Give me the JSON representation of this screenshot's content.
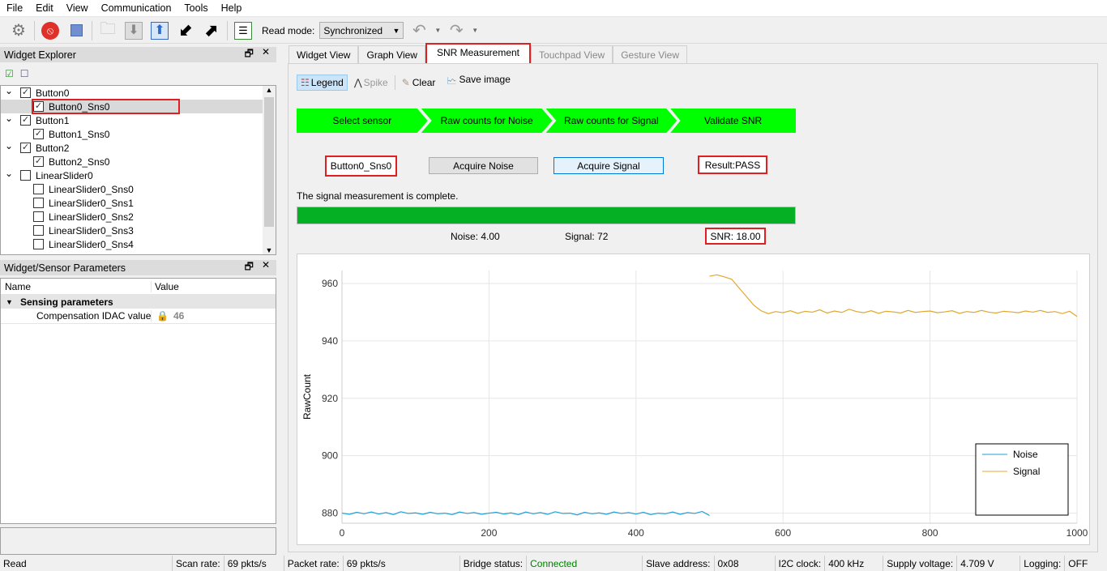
{
  "menu": [
    "File",
    "Edit",
    "View",
    "Communication",
    "Tools",
    "Help"
  ],
  "toolbar": {
    "read_mode_label": "Read mode:",
    "read_mode_value": "Synchronized"
  },
  "widget_explorer": {
    "title": "Widget Explorer",
    "items": [
      {
        "label": "Button0",
        "level": 0,
        "checked": true
      },
      {
        "label": "Button0_Sns0",
        "level": 1,
        "checked": true,
        "selected": true
      },
      {
        "label": "Button1",
        "level": 0,
        "checked": true
      },
      {
        "label": "Button1_Sns0",
        "level": 1,
        "checked": true
      },
      {
        "label": "Button2",
        "level": 0,
        "checked": true
      },
      {
        "label": "Button2_Sns0",
        "level": 1,
        "checked": true
      },
      {
        "label": "LinearSlider0",
        "level": 0,
        "checked": false
      },
      {
        "label": "LinearSlider0_Sns0",
        "level": 1,
        "checked": false
      },
      {
        "label": "LinearSlider0_Sns1",
        "level": 1,
        "checked": false
      },
      {
        "label": "LinearSlider0_Sns2",
        "level": 1,
        "checked": false
      },
      {
        "label": "LinearSlider0_Sns3",
        "level": 1,
        "checked": false
      },
      {
        "label": "LinearSlider0_Sns4",
        "level": 1,
        "checked": false
      }
    ]
  },
  "params": {
    "title": "Widget/Sensor Parameters",
    "col_name": "Name",
    "col_value": "Value",
    "group": "Sensing parameters",
    "row_name": "Compensation IDAC value",
    "row_value": "46"
  },
  "tabs": [
    {
      "label": "Widget View"
    },
    {
      "label": "Graph View"
    },
    {
      "label": "SNR Measurement",
      "active": true
    },
    {
      "label": "Touchpad View",
      "disabled": true
    },
    {
      "label": "Gesture View",
      "disabled": true
    }
  ],
  "snr_toolbar": {
    "legend": "Legend",
    "spike": "Spike",
    "clear": "Clear",
    "save_image": "Save image"
  },
  "steps": [
    "Select sensor",
    "Raw counts for Noise",
    "Raw counts for Signal",
    "Validate SNR"
  ],
  "sensor": "Button0_Sns0",
  "acquire_noise": "Acquire Noise",
  "acquire_signal": "Acquire Signal",
  "result": "Result:PASS",
  "message": "The signal measurement is complete.",
  "progress_percent": 100,
  "noise_label": "Noise:  4.00",
  "signal_label": "Signal:  72",
  "snr_label": "SNR:  18.00",
  "colors": {
    "step": "#00ff00",
    "progress": "#06b025",
    "noise": "#1f9fd6",
    "signal": "#e0a830",
    "highlight": "#e02020",
    "connected": "#008000"
  },
  "chart_data": {
    "type": "line",
    "xlabel": "",
    "ylabel": "RawCount",
    "xlim": [
      0,
      1000
    ],
    "ylim": [
      876.5,
      964.5
    ],
    "xticks": [
      0,
      200,
      400,
      600,
      800,
      1000
    ],
    "yticks": [
      880,
      900,
      920,
      940,
      960
    ],
    "grid": true,
    "legend_position": "bottom-right",
    "series": [
      {
        "name": "Noise",
        "x": [
          0,
          10,
          20,
          30,
          40,
          50,
          60,
          70,
          80,
          90,
          100,
          110,
          120,
          130,
          140,
          150,
          160,
          170,
          180,
          190,
          200,
          210,
          220,
          230,
          240,
          250,
          260,
          270,
          280,
          290,
          300,
          310,
          320,
          330,
          340,
          350,
          360,
          370,
          380,
          390,
          400,
          410,
          420,
          430,
          440,
          450,
          460,
          470,
          480,
          490,
          500
        ],
        "y": [
          880,
          879.6,
          880.3,
          879.8,
          880.4,
          879.7,
          880.2,
          879.5,
          880.5,
          879.9,
          880.1,
          879.6,
          880.3,
          879.8,
          880,
          879.5,
          880.4,
          879.9,
          880.2,
          879.6,
          880,
          880.3,
          879.7,
          880.1,
          879.5,
          880.4,
          879.8,
          880.2,
          879.6,
          880.5,
          879.9,
          880,
          879.4,
          880.3,
          879.8,
          880.1,
          879.6,
          880.4,
          879.9,
          880.2,
          879.7,
          880.3,
          879.5,
          880,
          879.8,
          880.4,
          879.6,
          880.2,
          879.9,
          880.6,
          879.2
        ]
      },
      {
        "name": "Signal",
        "x": [
          500,
          510,
          520,
          530,
          540,
          550,
          560,
          570,
          580,
          590,
          600,
          610,
          620,
          630,
          640,
          650,
          660,
          670,
          680,
          690,
          700,
          710,
          720,
          730,
          740,
          750,
          760,
          770,
          780,
          790,
          800,
          810,
          820,
          830,
          840,
          850,
          860,
          870,
          880,
          890,
          900,
          910,
          920,
          930,
          940,
          950,
          960,
          970,
          980,
          990,
          1000
        ],
        "y": [
          962.5,
          963,
          962.3,
          961.5,
          958.5,
          955.5,
          952.5,
          950.5,
          949.5,
          950.2,
          949.8,
          950.5,
          949.6,
          950.3,
          950,
          950.8,
          949.7,
          950.4,
          949.9,
          951,
          950.2,
          949.8,
          950.5,
          949.6,
          950.3,
          950.1,
          949.7,
          950.6,
          949.9,
          950.2,
          950.4,
          949.8,
          950.1,
          950.5,
          949.6,
          950.2,
          949.9,
          950.6,
          950,
          949.7,
          950.3,
          950.1,
          949.8,
          950.4,
          950,
          950.6,
          949.9,
          950.2,
          949.5,
          950.3,
          948.5
        ]
      }
    ]
  },
  "statusbar": {
    "read": "Read",
    "scan_rate_label": "Scan rate:",
    "scan_rate": "69 pkts/s",
    "packet_rate_label": "Packet rate:",
    "packet_rate": "69 pkts/s",
    "bridge_label": "Bridge status:",
    "bridge": "Connected",
    "slave_label": "Slave address:",
    "slave": "0x08",
    "i2c_label": "I2C clock:",
    "i2c": "400 kHz",
    "supply_label": "Supply voltage:",
    "supply": "4.709 V",
    "logging_label": "Logging:",
    "logging": "OFF"
  }
}
